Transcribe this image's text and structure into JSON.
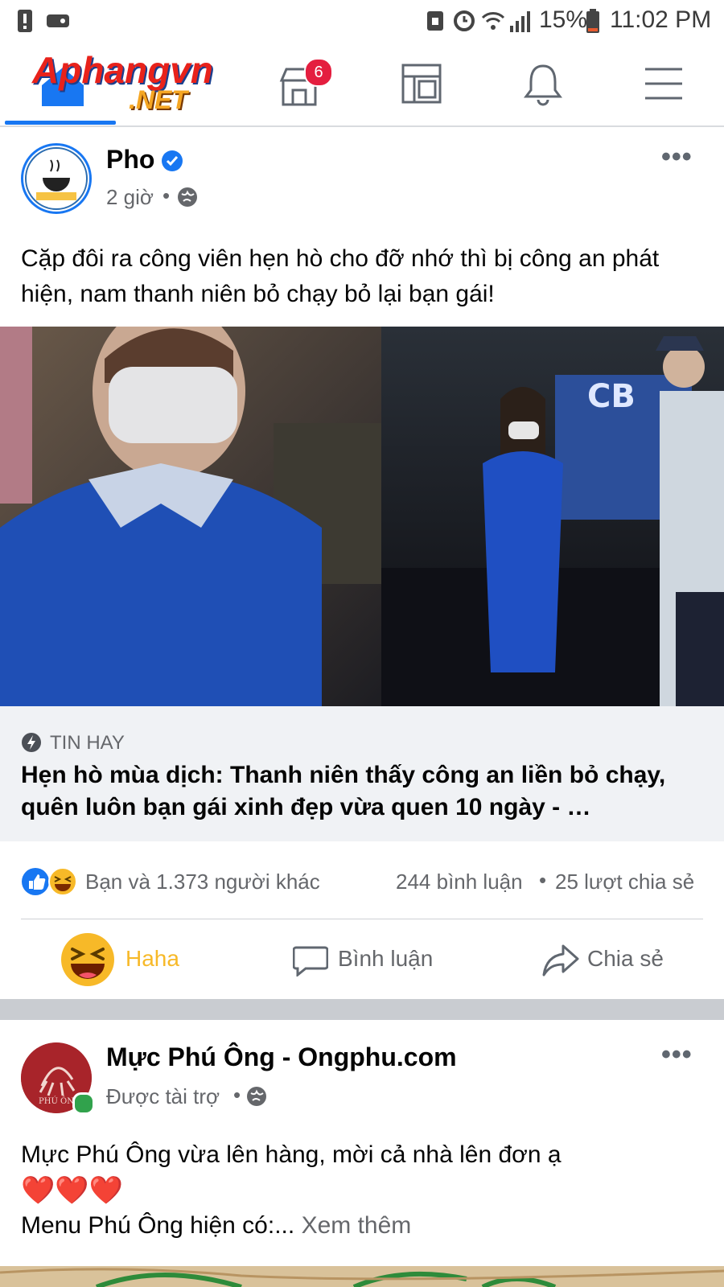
{
  "status": {
    "battery": "15%",
    "time": "11:02 PM"
  },
  "logo": {
    "text_main": "Aphangvn",
    "text_sub": ".NET"
  },
  "nav": {
    "marketplace_badge": "6"
  },
  "post1": {
    "author": "Pho",
    "time": "2 giờ",
    "text": "Cặp đôi ra công viên hẹn hò cho đỡ nhớ thì bị công an phát hiện, nam thanh niên bỏ chạy bỏ lại bạn gái!",
    "link_source": "TIN HAY",
    "link_title": "Hẹn hò mùa dịch: Thanh niên thấy công an liền bỏ chạy, quên luôn bạn gái xinh đẹp vừa quen 10 ngày - …",
    "reactions_text": "Bạn và 1.373 người khác",
    "comments": "244 bình luận",
    "shares": "25 lượt chia sẻ",
    "action_reaction": "Haha",
    "action_comment": "Bình luận",
    "action_share": "Chia sẻ"
  },
  "post2": {
    "author": "Mực Phú Ông - Ongphu.com",
    "meta": "Được tài trợ",
    "text_line1": "Mực Phú Ông vừa lên hàng, mời cả nhà lên đơn ạ",
    "hearts": "❤️❤️❤️",
    "text_line3": "Menu Phú Ông hiện có:...",
    "see_more": "Xem thêm"
  },
  "colors": {
    "accent": "#1877f2",
    "haha": "#f7b928",
    "badge": "#e41e3f"
  }
}
